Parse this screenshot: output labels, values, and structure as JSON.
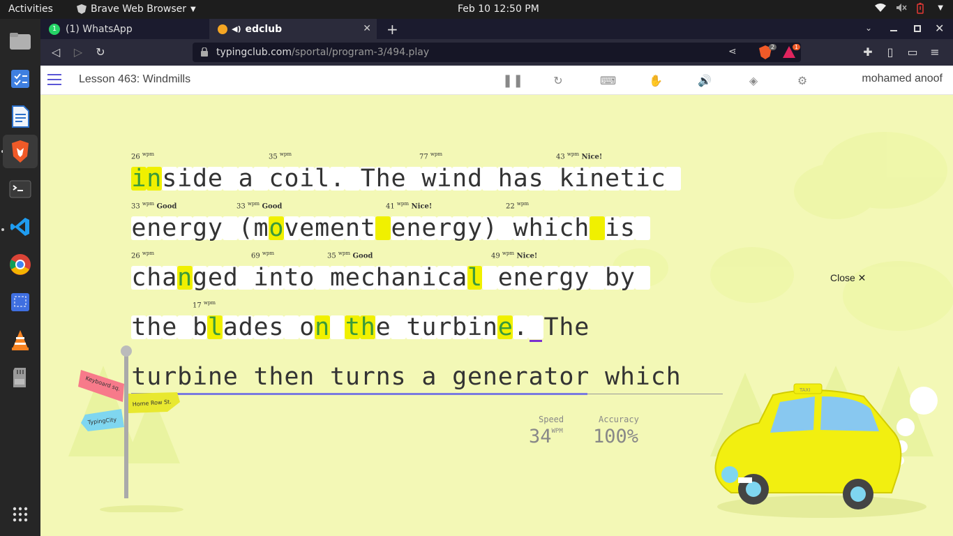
{
  "system": {
    "activities": "Activities",
    "app_name": "Brave Web Browser",
    "datetime": "Feb 10  12:50 PM"
  },
  "browser": {
    "tabs": [
      {
        "label": "(1) WhatsApp",
        "badge": "1"
      },
      {
        "label": "edclub"
      }
    ],
    "url_domain": "typingclub.com",
    "url_path": "/sportal/program-3/494.play",
    "brave_badge": "2",
    "rewards_badge": "1"
  },
  "lesson": {
    "title": "Lesson 463: Windmills",
    "user": "mohamed anoof"
  },
  "typing": {
    "lines": [
      "inside a coil. The wind has kinetic ",
      "energy (movement energy) which is ",
      "changed into mechanical energy by ",
      "the blades on the turbine. The",
      "turbine then turns a generator which"
    ],
    "wpm_labels": [
      {
        "value": "26",
        "unit": "wpm",
        "tag": ""
      },
      {
        "value": "35",
        "unit": "wpm",
        "tag": ""
      },
      {
        "value": "77",
        "unit": "wpm",
        "tag": ""
      },
      {
        "value": "43",
        "unit": "wpm",
        "tag": "Nice!"
      },
      {
        "value": "33",
        "unit": "wpm",
        "tag": "Good"
      },
      {
        "value": "33",
        "unit": "wpm",
        "tag": "Good"
      },
      {
        "value": "41",
        "unit": "wpm",
        "tag": "Nice!"
      },
      {
        "value": "22",
        "unit": "wpm",
        "tag": ""
      },
      {
        "value": "26",
        "unit": "wpm",
        "tag": ""
      },
      {
        "value": "69",
        "unit": "wpm",
        "tag": ""
      },
      {
        "value": "35",
        "unit": "wpm",
        "tag": "Good"
      },
      {
        "value": "49",
        "unit": "wpm",
        "tag": "Nice!"
      },
      {
        "value": "17",
        "unit": "wpm",
        "tag": ""
      }
    ]
  },
  "close_label": "Close ✕",
  "stats": {
    "speed_label": "Speed",
    "speed_value": "34",
    "speed_unit": "WPM",
    "accuracy_label": "Accuracy",
    "accuracy_value": "100%"
  },
  "signpost": {
    "sign1": "Keyboard sq.",
    "sign2": "Home Row St.",
    "sign3": "TypingCity"
  },
  "taxi_label": "TAXI"
}
